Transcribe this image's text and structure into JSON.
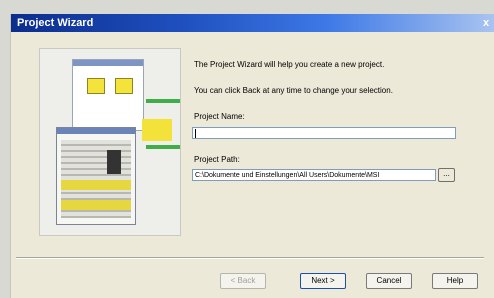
{
  "window": {
    "title": "Project Wizard",
    "close_glyph": "x"
  },
  "intro": {
    "line1": "The Project Wizard will help you create a new project.",
    "line2": "You can click Back at any time to change your selection."
  },
  "project_name": {
    "label": "Project Name:",
    "value": ""
  },
  "project_path": {
    "label": "Project Path:",
    "value": "C:\\Dokumente und Einstellungen\\All Users\\Dokumente\\MSI",
    "browse_label": "..."
  },
  "buttons": {
    "back": "< Back",
    "next": "Next >",
    "cancel": "Cancel",
    "help": "Help"
  }
}
